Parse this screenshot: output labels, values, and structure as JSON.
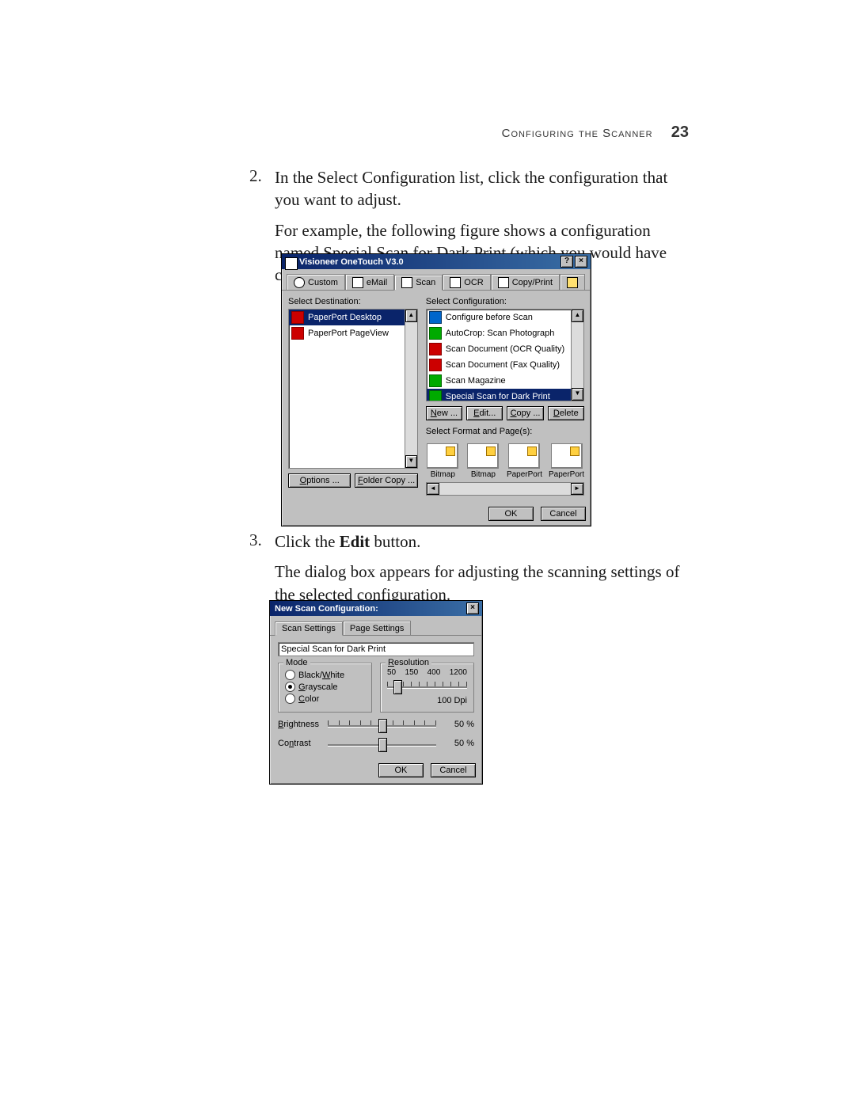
{
  "header": {
    "section": "Configuring the Scanner",
    "page": "23"
  },
  "step2": {
    "num": "2.",
    "p1": "In the Select Configuration list, click the configuration that you want to adjust.",
    "p2": "For example, the following figure shows a configuration named Special Scan for Dark Print (which you would have created earlier)."
  },
  "step3": {
    "num": "3.",
    "p1a": "Click the ",
    "p1b": "Edit",
    "p1c": " button.",
    "p2": "The dialog box appears for adjusting the scanning settings of the selected configuration."
  },
  "dlgA": {
    "title": "Visioneer OneTouch V3.0",
    "help": "?",
    "close": "×",
    "tabs": {
      "custom": "Custom",
      "email": "eMail",
      "scan": "Scan",
      "ocr": "OCR",
      "copy": "Copy/Print",
      "last": ""
    },
    "left": {
      "label": "Select Destination:",
      "items": [
        "PaperPort Desktop",
        "PaperPort PageView"
      ],
      "options": "Options ...",
      "foldercopy": "Folder Copy ..."
    },
    "right": {
      "label": "Select Configuration:",
      "items": [
        "Configure before Scan",
        "AutoCrop: Scan Photograph",
        "Scan Document (OCR Quality)",
        "Scan Document (Fax Quality)",
        "Scan Magazine",
        "Special Scan for Dark Print"
      ],
      "new": "New ...",
      "edit": "Edit...",
      "copy": "Copy ...",
      "delete": "Delete",
      "fmtlabel": "Select Format and Page(s):",
      "fmts": [
        "Bitmap",
        "Bitmap",
        "PaperPort",
        "PaperPort"
      ]
    },
    "footer": {
      "ok": "OK",
      "cancel": "Cancel"
    }
  },
  "dlgB": {
    "title": "New Scan Configuration:",
    "close": "×",
    "tabs": {
      "scan": "Scan Settings",
      "page": "Page Settings"
    },
    "name_value": "Special Scan for Dark Print",
    "mode": {
      "title": "Mode",
      "bw": "Black/White",
      "gray": "Grayscale",
      "color": "Color"
    },
    "res": {
      "title": "Resolution",
      "scale": [
        "50",
        "150",
        "400",
        "1200"
      ],
      "value": "100 Dpi"
    },
    "brightness": {
      "label": "Brightness",
      "value": "50 %"
    },
    "contrast": {
      "label": "Contrast",
      "value": "50 %"
    },
    "footer": {
      "ok": "OK",
      "cancel": "Cancel"
    }
  }
}
